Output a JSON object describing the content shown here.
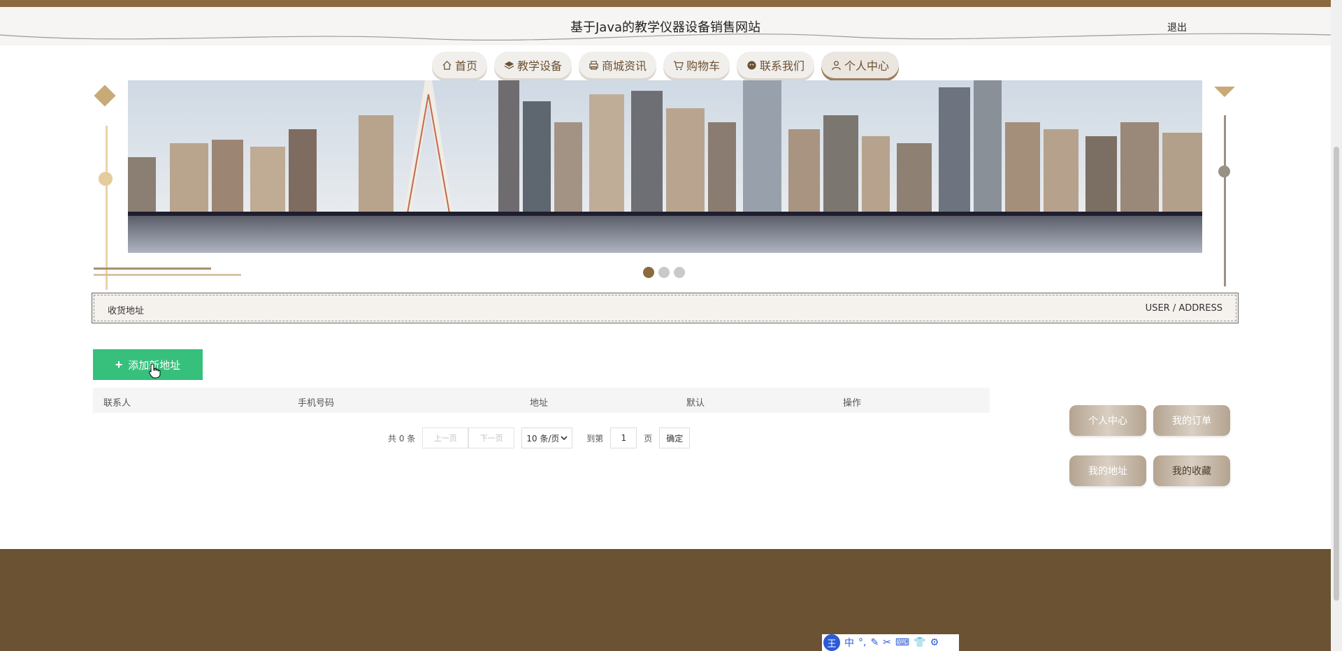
{
  "header": {
    "site_title": "基于Java的教学仪器设备销售网站",
    "logout_label": "退出"
  },
  "nav": {
    "items": [
      {
        "label": "首页",
        "icon": "home-icon"
      },
      {
        "label": "教学设备",
        "icon": "layers-icon"
      },
      {
        "label": "商城资讯",
        "icon": "printer-icon"
      },
      {
        "label": "购物车",
        "icon": "cart-icon"
      },
      {
        "label": "联系我们",
        "icon": "chat-icon"
      },
      {
        "label": "个人中心",
        "icon": "user-icon",
        "active": true
      }
    ]
  },
  "carousel": {
    "slide_count": 3,
    "active_index": 0
  },
  "section": {
    "title": "收货地址",
    "subtitle": "USER / ADDRESS"
  },
  "actions": {
    "add_label": "添加新地址"
  },
  "table": {
    "columns": [
      "联系人",
      "手机号码",
      "地址",
      "默认",
      "操作"
    ],
    "rows": []
  },
  "pager": {
    "total_text": "共 0 条",
    "prev_label": "上一页",
    "next_label": "下一页",
    "page_size_label": "10 条/页",
    "goto_label": "到第",
    "page_value": "1",
    "page_unit": "页",
    "confirm_label": "确定"
  },
  "side_menu": {
    "items": [
      "个人中心",
      "我的订单",
      "我的地址",
      "我的收藏"
    ]
  },
  "ime": {
    "logo": "王",
    "mode": "中"
  },
  "colors": {
    "brand_brown": "#8b6a3e",
    "footer_brown": "#6b5233",
    "add_green": "#36c07c",
    "dot_active": "#8b6a3e"
  }
}
